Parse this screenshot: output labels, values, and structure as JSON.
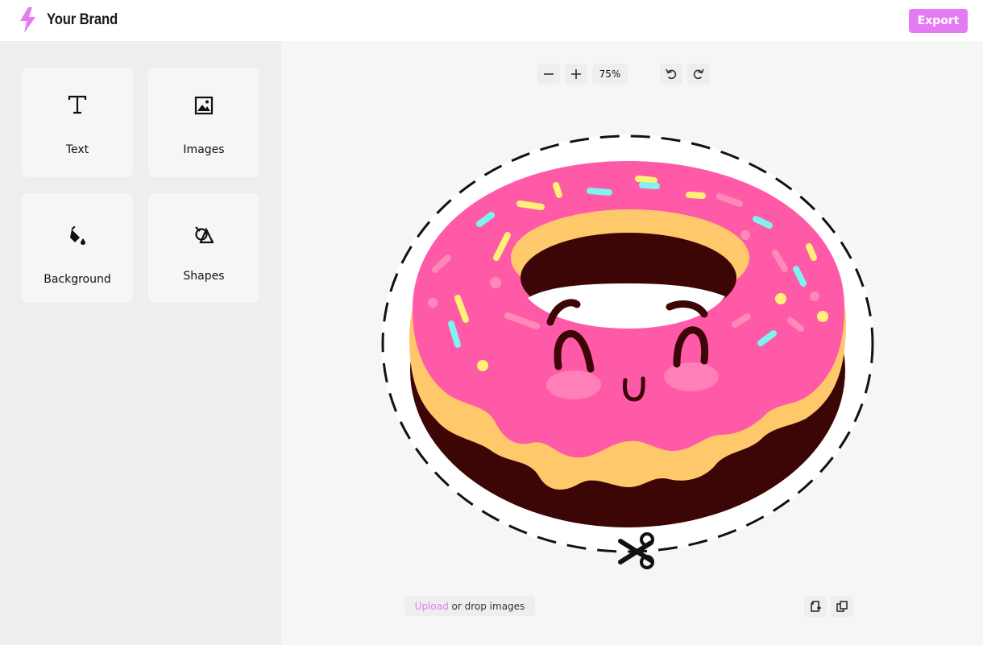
{
  "header": {
    "brand_name": "Your Brand",
    "logo_icon": "lightning-bolt-icon",
    "export_label": "Export",
    "accent_color": "#e57bf4"
  },
  "sidebar": {
    "tools": [
      {
        "label": "Text",
        "icon": "text-icon"
      },
      {
        "label": "Images",
        "icon": "image-icon"
      },
      {
        "label": "Background",
        "icon": "paint-bucket-icon"
      },
      {
        "label": "Shapes",
        "icon": "shapes-icon"
      }
    ]
  },
  "toolbar": {
    "zoom_level": "75%",
    "zoom_out_icon": "minus-icon",
    "zoom_in_icon": "plus-icon",
    "undo_icon": "undo-icon",
    "redo_icon": "redo-icon"
  },
  "canvas": {
    "artwork": "donut-sticker",
    "cut_line_icon": "scissors-icon"
  },
  "footer": {
    "upload_link": "Upload",
    "upload_text": " or drop images",
    "add_page_icon": "add-page-icon",
    "duplicate_icon": "duplicate-icon"
  }
}
